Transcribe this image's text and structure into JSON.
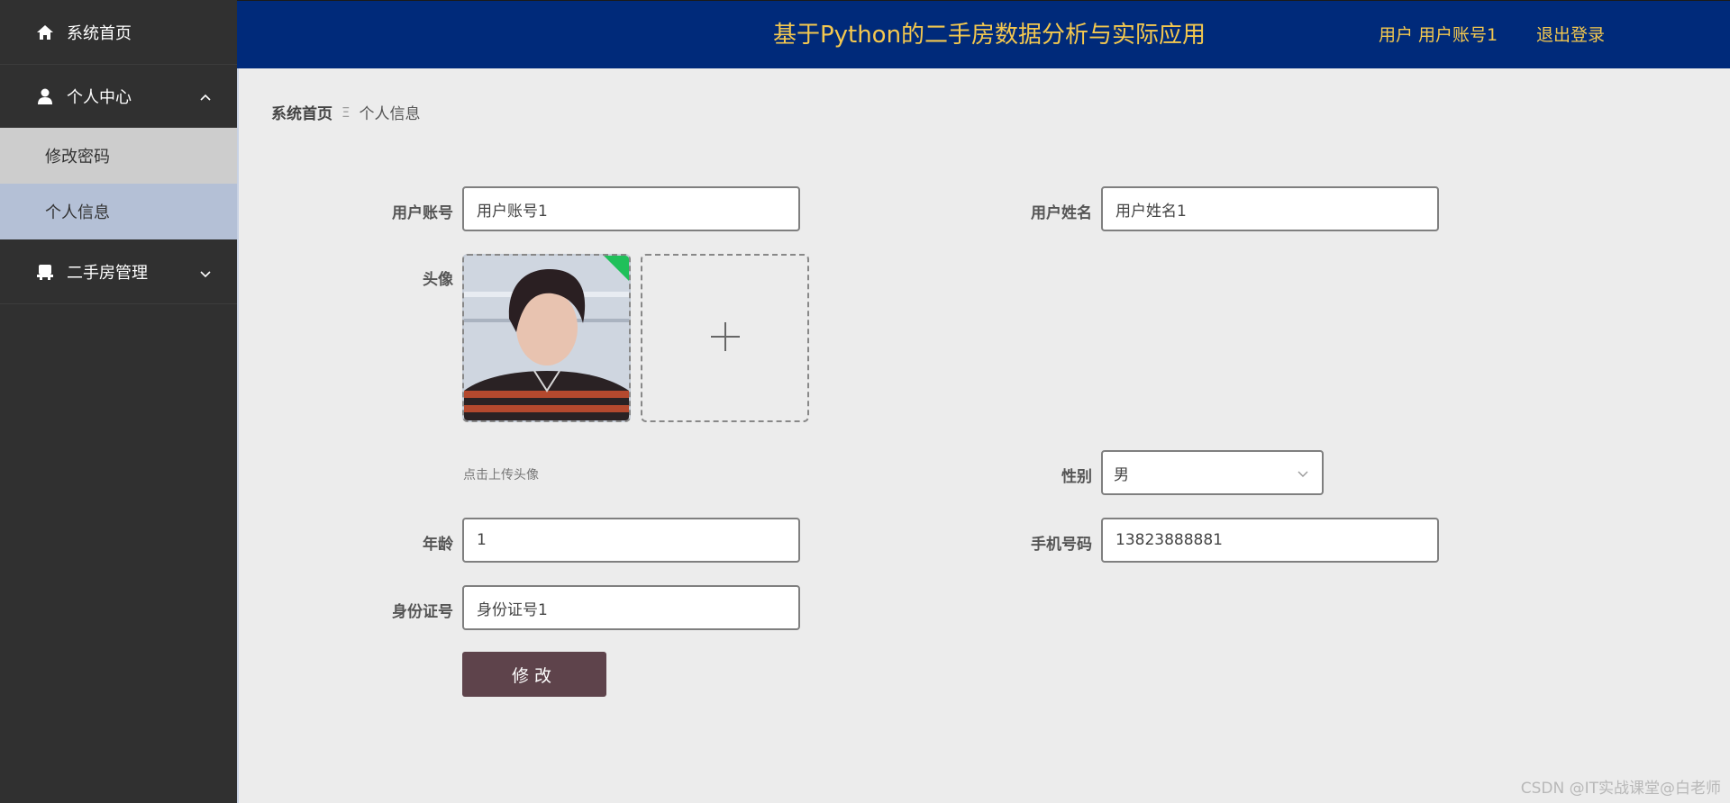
{
  "sidebar": {
    "home": "系统首页",
    "personal_center": "个人中心",
    "sub_items": [
      "修改密码",
      "个人信息"
    ],
    "house_mgmt": "二手房管理"
  },
  "header": {
    "title": "基于Python的二手房数据分析与实际应用",
    "user": "用户 用户账号1",
    "logout": "退出登录"
  },
  "breadcrumb": {
    "home": "系统首页",
    "separator": "Ξ",
    "current": "个人信息"
  },
  "form": {
    "account_label": "用户账号",
    "account_value": "用户账号1",
    "name_label": "用户姓名",
    "name_value": "用户姓名1",
    "avatar_label": "头像",
    "avatar_hint": "点击上传头像",
    "gender_label": "性别",
    "gender_value": "男",
    "age_label": "年龄",
    "age_value": "1",
    "phone_label": "手机号码",
    "phone_value": "13823888881",
    "id_label": "身份证号",
    "id_value": "身份证号1",
    "submit_label": "修改"
  },
  "watermark": "CSDN @IT实战课堂@白老师",
  "colors": {
    "sidebar_bg": "#303030",
    "header_bg": "#002a7a",
    "header_text": "#f4c84f",
    "active_sub": "#b4c0d6",
    "button_bg": "#5e434b"
  }
}
